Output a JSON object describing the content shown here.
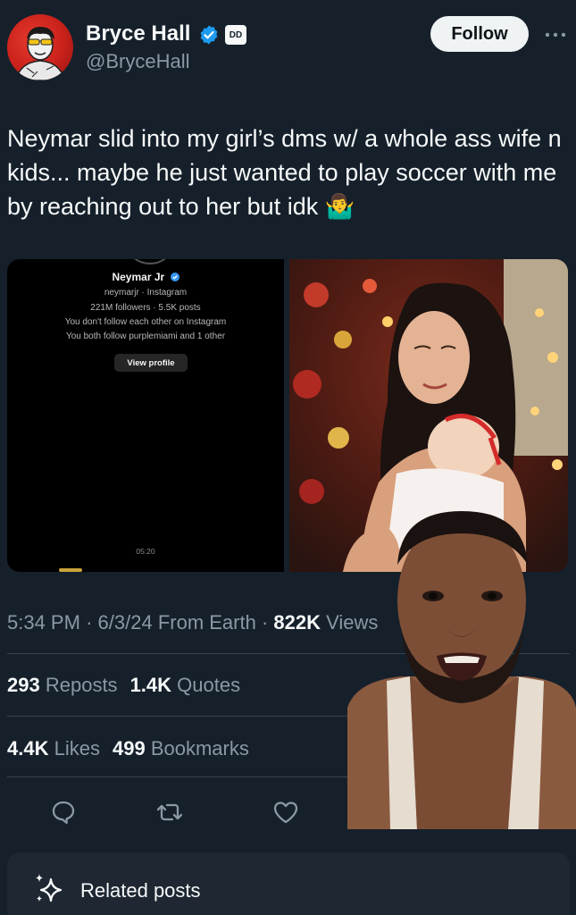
{
  "author": {
    "display_name": "Bryce Hall",
    "handle": "@BryceHall",
    "verified": true,
    "affiliate_badge": "DD"
  },
  "follow_label": "Follow",
  "tweet_text": "Neymar slid into my girl’s dms w/ a whole ass wife n kids... maybe he just wanted to play soccer with me by reaching out to her but idk 🤷‍♂️",
  "media": {
    "instagram_dm": {
      "name": "Neymar Jr",
      "subtitle": "neymarjr · Instagram",
      "stats": "221M followers · 5.5K posts",
      "follow_status": "You don't follow each other on Instagram",
      "mutuals": "You both follow purplemiami and 1 other",
      "view_profile_label": "View profile",
      "time": "05:20"
    }
  },
  "meta": {
    "time": "5:34 PM",
    "date": "6/3/24",
    "source": "From Earth",
    "views_count": "822K",
    "views_label": "Views"
  },
  "stats": {
    "reposts_count": "293",
    "reposts_label": "Reposts",
    "quotes_count": "1.4K",
    "quotes_label": "Quotes",
    "likes_count": "4.4K",
    "likes_label": "Likes",
    "bookmarks_count": "499",
    "bookmarks_label": "Bookmarks"
  },
  "related_posts_label": "Related posts",
  "colors": {
    "background": "#15202b",
    "text_primary": "#f7f9f9",
    "text_secondary": "#8b98a5",
    "verified_blue": "#1d9bf0",
    "divider": "#38444d"
  },
  "icons": [
    "more-icon",
    "verified-icon",
    "reply-icon",
    "repost-icon",
    "like-icon",
    "sparkle-icon"
  ]
}
